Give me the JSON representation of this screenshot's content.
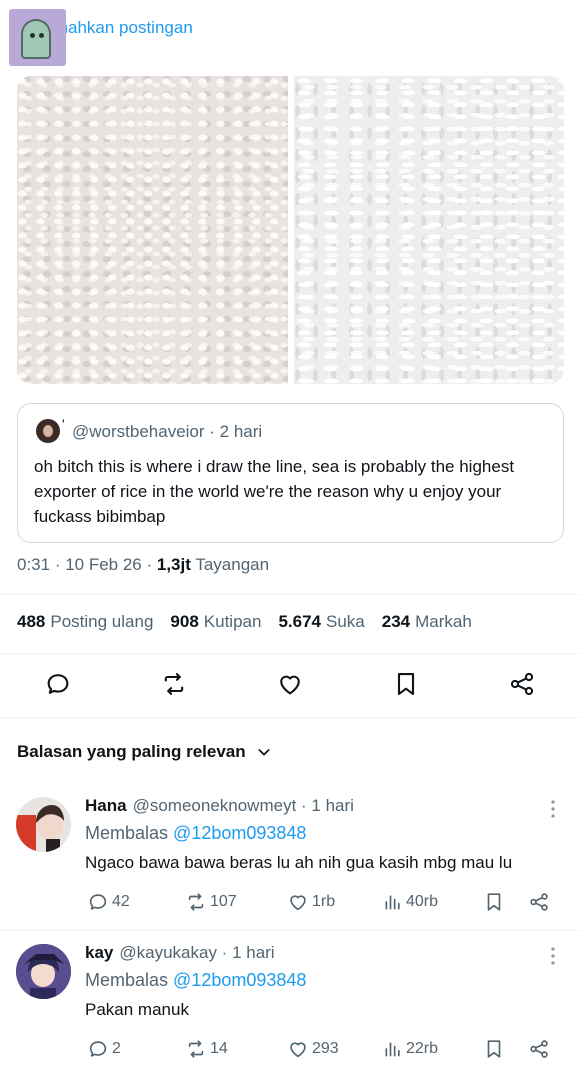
{
  "translate_label": "Terjemahkan postingan",
  "quoted": {
    "handle": "@worstbehaveior",
    "time": "2 hari",
    "text": "oh bitch this is where i draw the line, sea is probably the highest exporter of rice in the world we're the reason why u enjoy your fuckass bibimbap"
  },
  "meta": {
    "time": "0:31",
    "date": "10 Feb 26",
    "views_count": "1,3jt",
    "views_label": "Tayangan"
  },
  "stats": {
    "reposts_count": "488",
    "reposts_label": "Posting ulang",
    "quotes_count": "908",
    "quotes_label": "Kutipan",
    "likes_count": "5.674",
    "likes_label": "Suka",
    "bookmarks_count": "234",
    "bookmarks_label": "Markah"
  },
  "sort_label": "Balasan yang paling relevan",
  "replies": [
    {
      "name": "Hana",
      "handle": "@someoneknowmeyt",
      "time": "1 hari",
      "replying_prefix": "Membalas",
      "replying_to": "@12bom093848",
      "text": "Ngaco bawa bawa beras lu ah nih gua kasih mbg mau lu",
      "replies": "42",
      "reposts": "107",
      "likes": "1rb",
      "views": "40rb"
    },
    {
      "name": "kay",
      "handle": "@kayukakay",
      "time": "1 hari",
      "replying_prefix": "Membalas",
      "replying_to": "@12bom093848",
      "text": "Pakan manuk",
      "replies": "2",
      "reposts": "14",
      "likes": "293",
      "views": "22rb"
    }
  ],
  "colors": {
    "accent": "#1d9bf0",
    "text": "#0f1419",
    "muted": "#536471",
    "border": "#cfd9de"
  }
}
